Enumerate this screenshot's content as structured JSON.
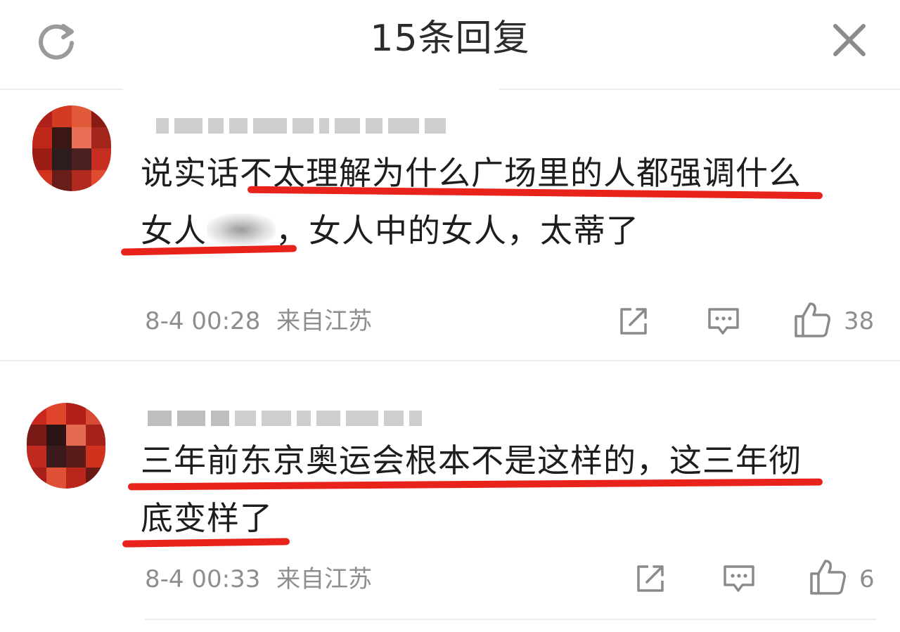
{
  "header": {
    "title": "15条回复",
    "refresh_icon": "refresh-icon",
    "close_icon": "close-icon"
  },
  "comments": [
    {
      "text_line1": "说实话不太理解为什么广场里的人都强调什么",
      "text_line2_a": "女人",
      "text_line2_b": "，女人中的女人，太蒂了",
      "time": "8-4 00:28",
      "location": "来自江苏",
      "likes": "38"
    },
    {
      "text_line1": "三年前东京奥运会根本不是这样的，这三年彻",
      "text_line2_a": "底变样了",
      "text_line2_b": "",
      "time": "8-4 00:33",
      "location": "来自江苏",
      "likes": "6"
    }
  ],
  "icons": {
    "share": "share-icon",
    "reply": "comment-icon",
    "like": "thumbs-up-icon"
  },
  "colors": {
    "underline": "#e8231c",
    "meta_text": "#8e8e8e",
    "body_text": "#1d1d1d"
  }
}
